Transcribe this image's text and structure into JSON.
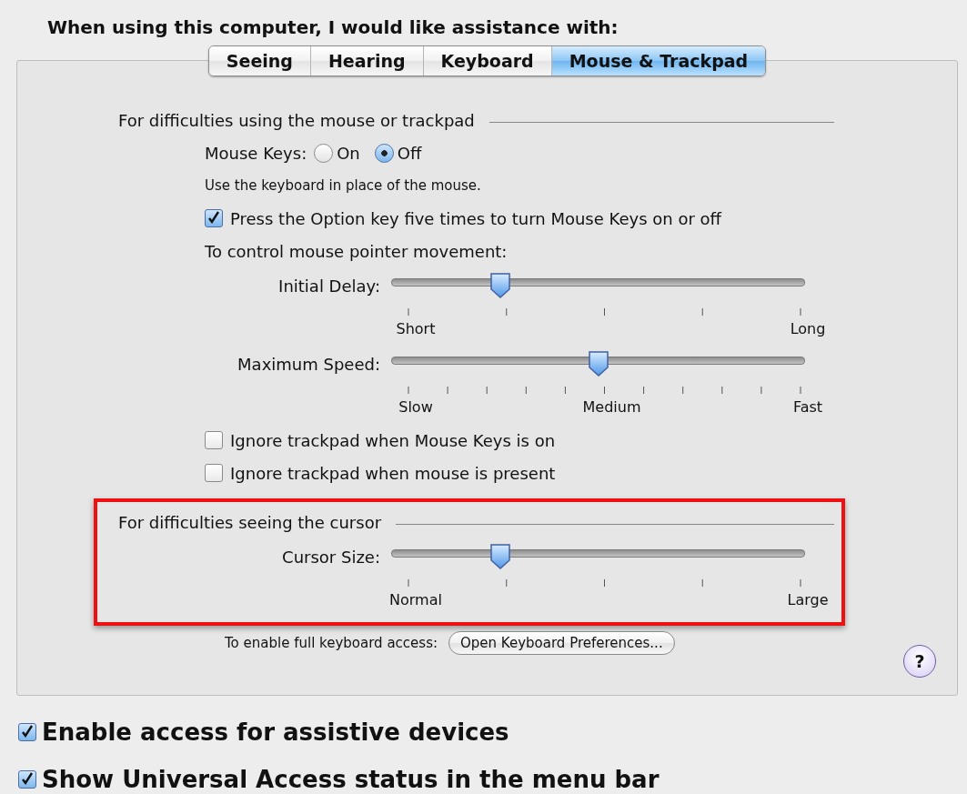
{
  "heading": "When using this computer, I would like assistance with:",
  "tabs": [
    {
      "label": "Seeing",
      "selected": false
    },
    {
      "label": "Hearing",
      "selected": false
    },
    {
      "label": "Keyboard",
      "selected": false
    },
    {
      "label": "Mouse & Trackpad",
      "selected": true
    }
  ],
  "sections": [
    {
      "title": "For difficulties using the mouse or trackpad",
      "highlighted": false,
      "rows": [
        {
          "kind": "radio",
          "label": "Mouse Keys:",
          "options": [
            {
              "label": "On",
              "selected": false
            },
            {
              "label": "Off",
              "selected": true
            }
          ]
        },
        {
          "kind": "note",
          "text": "Use the keyboard in place of the mouse."
        },
        {
          "kind": "checkbox",
          "label": "Press the Option key five times to turn Mouse Keys on or off",
          "checked": true
        },
        {
          "kind": "text",
          "text": "To control mouse pointer movement:"
        },
        {
          "kind": "slider",
          "label": "Initial Delay:",
          "level": 0.25,
          "ticks": [
            {
              "kind": "labeled",
              "label": "Short"
            },
            {
              "kind": "plain"
            },
            {
              "kind": "plain"
            },
            {
              "kind": "plain"
            },
            {
              "kind": "labeled",
              "label": "Long"
            }
          ]
        },
        {
          "kind": "slider",
          "label": "Maximum Speed:",
          "level": 0.5,
          "ticks": [
            {
              "kind": "labeled",
              "label": "Slow"
            },
            {
              "kind": "plain"
            },
            {
              "kind": "plain"
            },
            {
              "kind": "plain"
            },
            {
              "kind": "plain"
            },
            {
              "kind": "labeled",
              "label": "Medium"
            },
            {
              "kind": "plain"
            },
            {
              "kind": "plain"
            },
            {
              "kind": "plain"
            },
            {
              "kind": "plain"
            },
            {
              "kind": "labeled",
              "label": "Fast"
            }
          ]
        },
        {
          "kind": "checkbox",
          "label": "Ignore trackpad when Mouse Keys is on",
          "checked": false
        },
        {
          "kind": "checkbox",
          "label": "Ignore trackpad when mouse is present",
          "checked": false
        }
      ]
    },
    {
      "title": "For difficulties seeing the cursor",
      "highlighted": true,
      "rows": [
        {
          "kind": "slider",
          "label": "Cursor Size:",
          "level": 0.25,
          "ticks": [
            {
              "kind": "labeled",
              "label": "Normal"
            },
            {
              "kind": "plain"
            },
            {
              "kind": "plain"
            },
            {
              "kind": "plain"
            },
            {
              "kind": "labeled",
              "label": "Large"
            }
          ]
        }
      ]
    }
  ],
  "footer": {
    "label": "To enable full keyboard access:",
    "button": "Open Keyboard Preferences...",
    "help": "?"
  },
  "options": [
    {
      "label": "Enable access for assistive devices",
      "checked": true
    },
    {
      "label": "Show Universal Access status in the menu bar",
      "checked": true
    }
  ]
}
